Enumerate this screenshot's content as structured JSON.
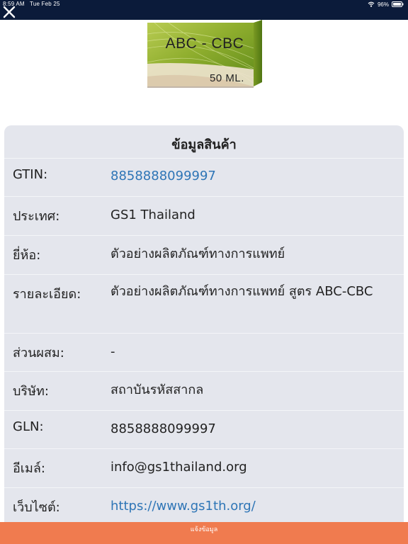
{
  "status_bar": {
    "time": "8:59 AM",
    "date": "Tue Feb 25",
    "battery": "96%"
  },
  "product_image": {
    "label_main": "ABC - CBC",
    "label_volume": "50 ML."
  },
  "card": {
    "title": "ข้อมูลสินค้า",
    "rows": [
      {
        "label": "GTIN:",
        "value": "8858888099997"
      },
      {
        "label": "ประเทศ:",
        "value": "GS1 Thailand"
      },
      {
        "label": "ยี่ห้อ:",
        "value": "ตัวอย่างผลิตภัณฑ์ทางการแพทย์"
      },
      {
        "label": "รายละเอียด:",
        "value": "ตัวอย่างผลิตภัณฑ์ทางการแพทย์ สูตร ABC-CBC"
      },
      {
        "label": "ส่วนผสม:",
        "value": "-"
      },
      {
        "label": "บริษัท:",
        "value": "สถาบันรหัสสากล"
      },
      {
        "label": "GLN:",
        "value": "8858888099997"
      },
      {
        "label": "อีเมล์:",
        "value": "info@gs1thailand.org"
      },
      {
        "label": "เว็บไซต์:",
        "value": "https://www.gs1th.org/"
      }
    ]
  },
  "report_button": {
    "label": "แจ้งข้อมูล"
  },
  "colors": {
    "status_bar_bg": "#0b1b3a",
    "card_bg": "#e4e6ed",
    "link": "#2e75b6",
    "button_bg": "#f07b4f"
  }
}
